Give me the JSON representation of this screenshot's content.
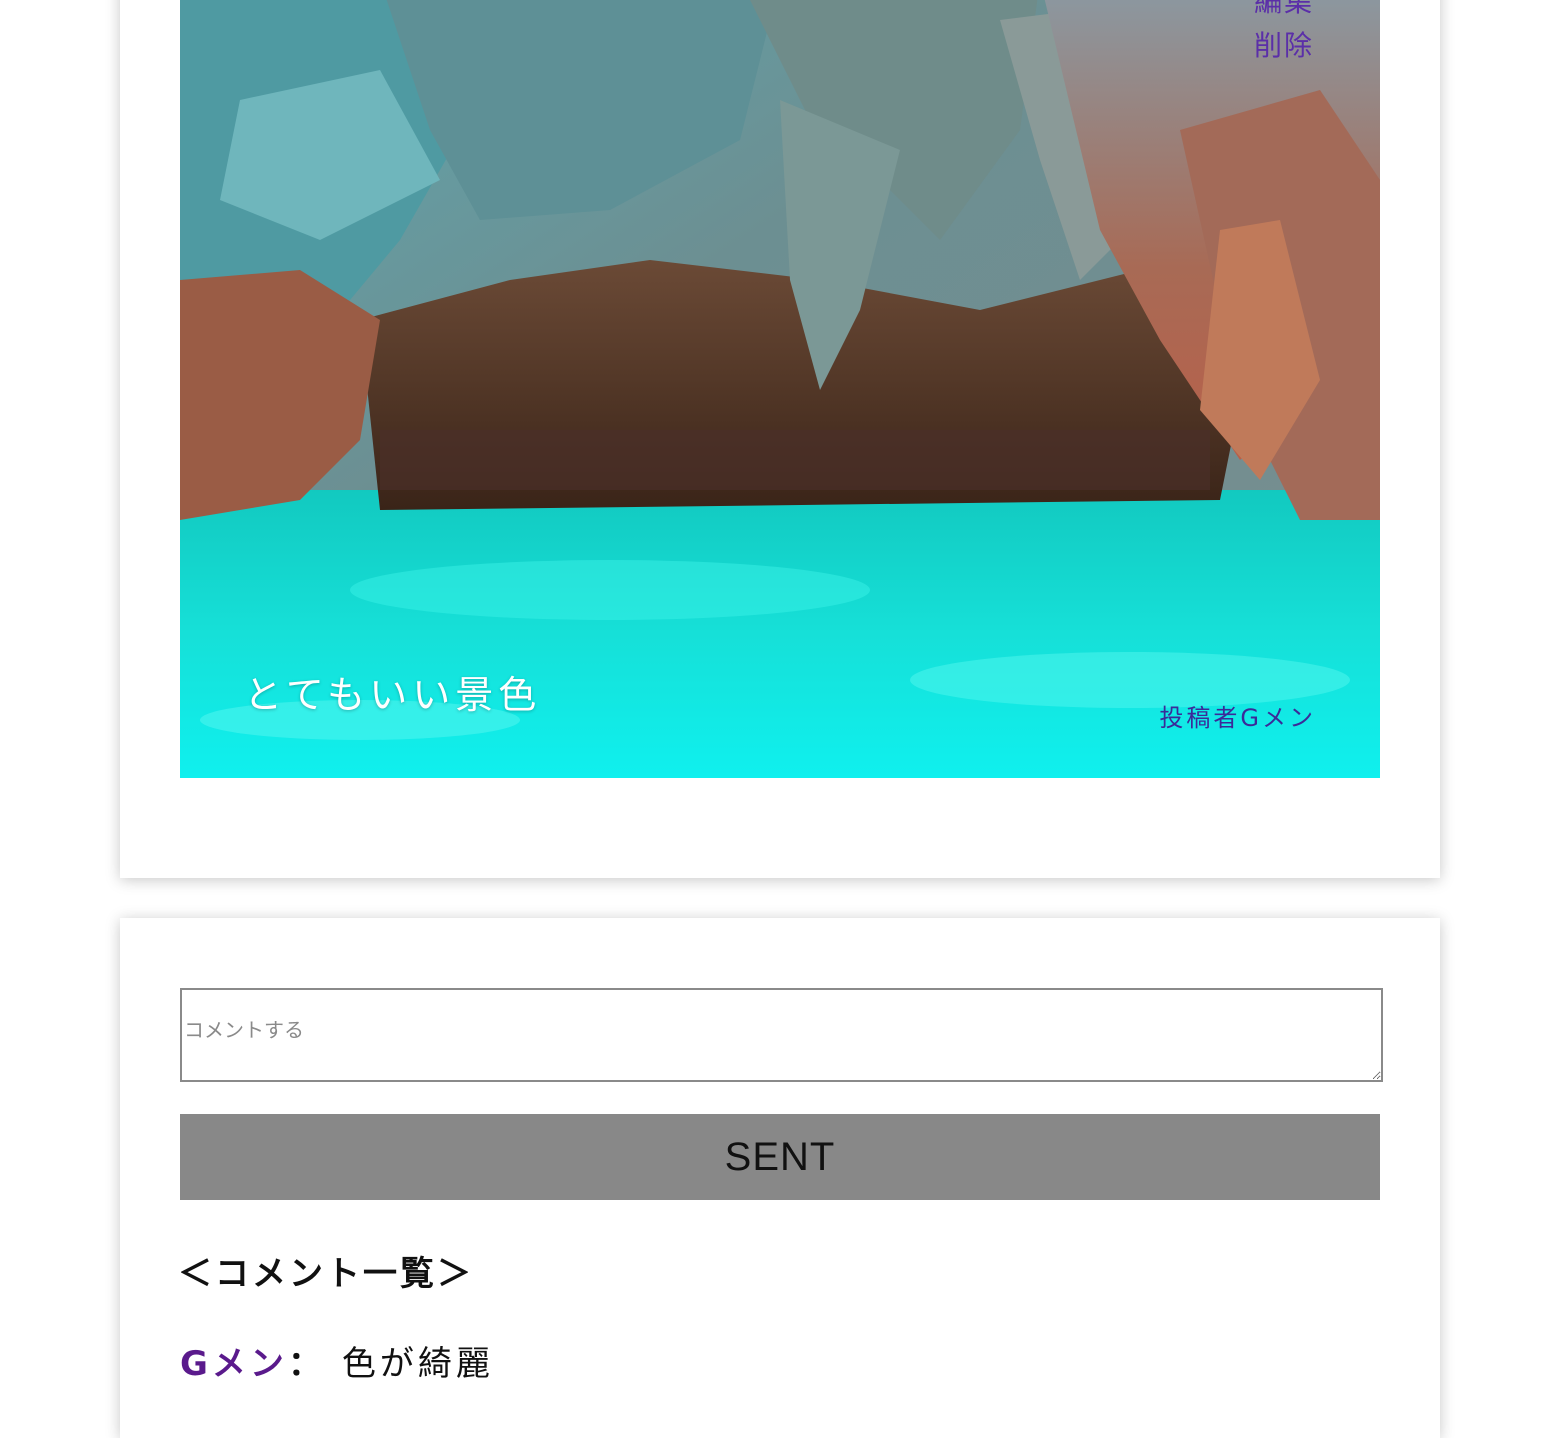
{
  "post": {
    "edit_label": "編集",
    "delete_label": "削除",
    "caption": "とてもいい景色",
    "poster_label": "投稿者Gメン"
  },
  "comment_form": {
    "placeholder": "コメントする",
    "value": "",
    "submit_label": "SENT"
  },
  "comments": {
    "heading": "＜コメント一覧＞",
    "items": [
      {
        "author": "Gメン",
        "separator": "：",
        "text": "色が綺麗"
      }
    ]
  },
  "colors": {
    "link_purple": "#5b2fa8",
    "author_purple": "#5a1a8c",
    "button_gray": "#888888",
    "water_turquoise": "#0fd9d2"
  }
}
